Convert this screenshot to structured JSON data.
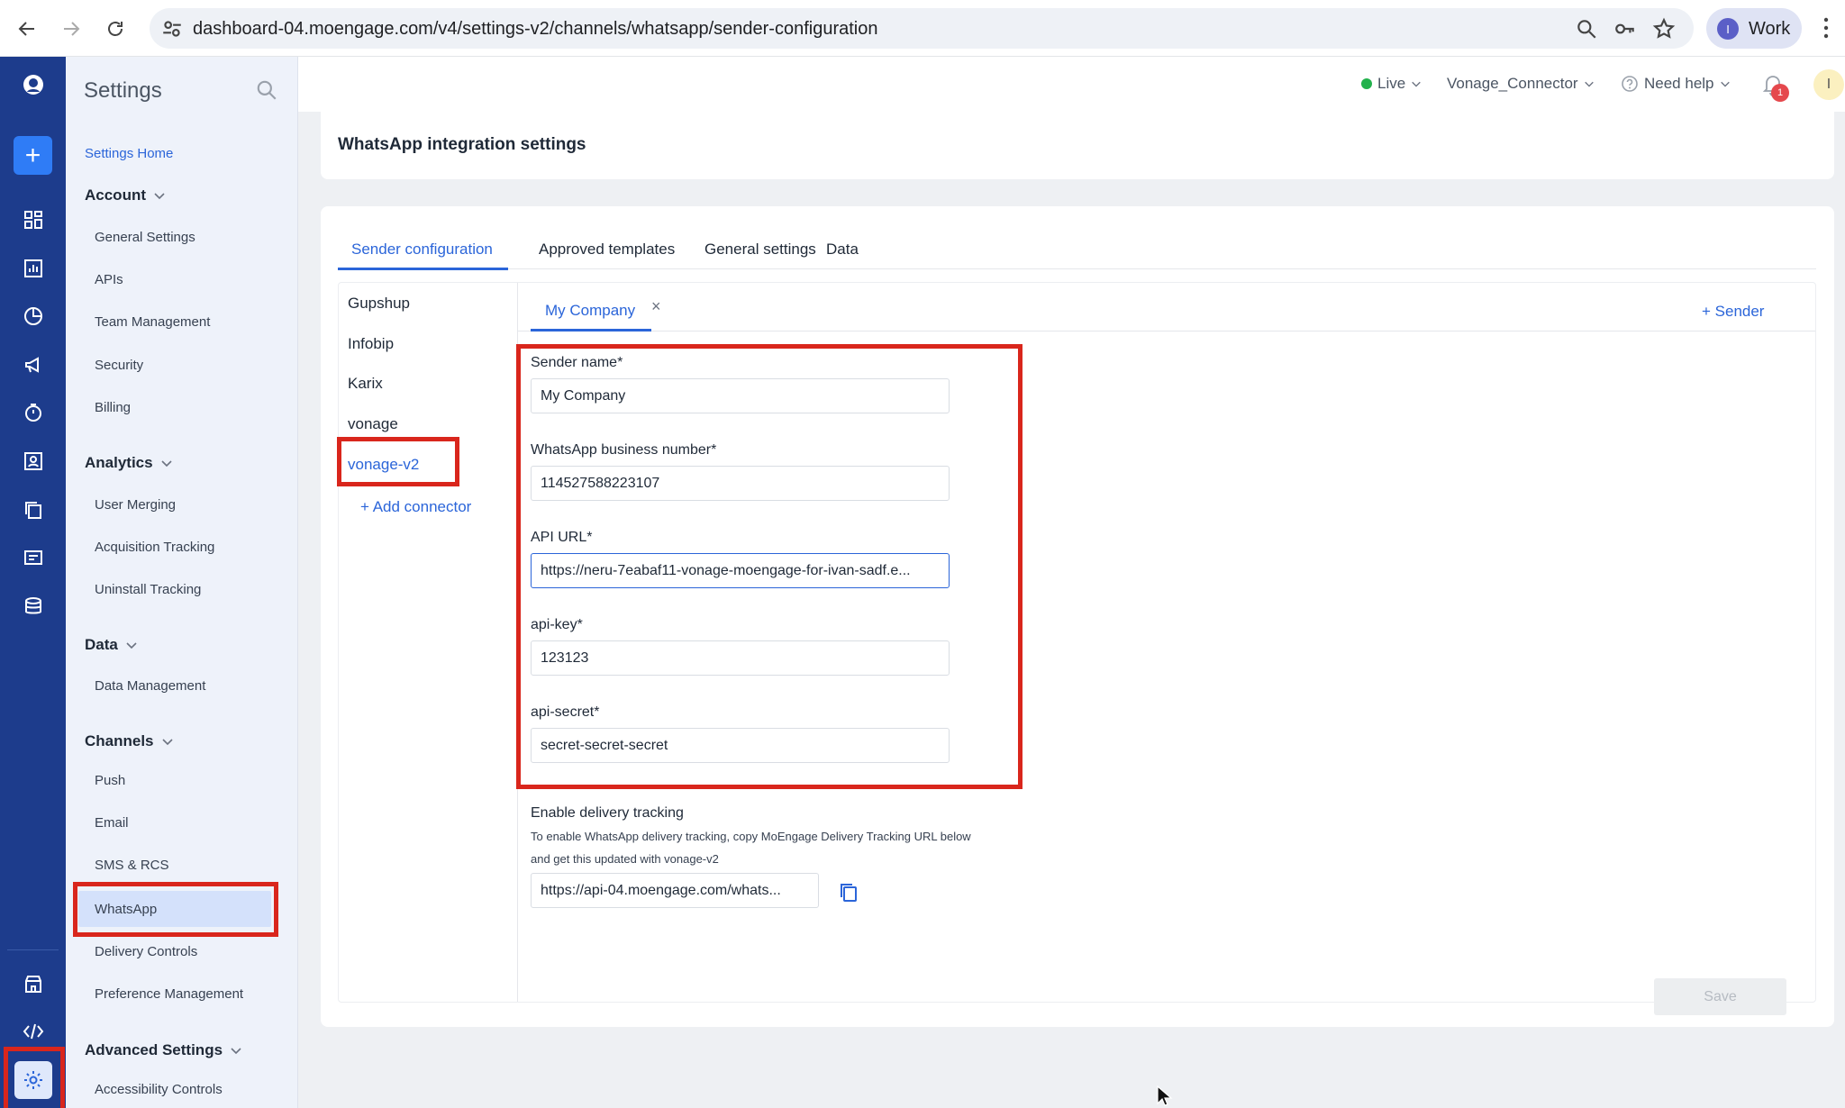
{
  "browser": {
    "url": "dashboard-04.moengage.com/v4/settings-v2/channels/whatsapp/sender-configuration",
    "profile_initial": "I",
    "profile_label": "Work"
  },
  "sidebar": {
    "title": "Settings",
    "home": "Settings Home",
    "sections": [
      {
        "title": "Account",
        "items": [
          "General Settings",
          "APIs",
          "Team Management",
          "Security",
          "Billing"
        ]
      },
      {
        "title": "Analytics",
        "items": [
          "User Merging",
          "Acquisition Tracking",
          "Uninstall Tracking"
        ]
      },
      {
        "title": "Data",
        "items": [
          "Data Management"
        ]
      },
      {
        "title": "Channels",
        "items": [
          "Push",
          "Email",
          "SMS & RCS",
          "WhatsApp",
          "Delivery Controls",
          "Preference Management"
        ]
      },
      {
        "title": "Advanced Settings",
        "items": [
          "Accessibility Controls"
        ]
      }
    ]
  },
  "topbar": {
    "env": "Live",
    "workspace": "Vonage_Connector",
    "help": "Need help",
    "notification_count": "1",
    "user_initial": "I"
  },
  "page": {
    "title": "WhatsApp integration settings",
    "tabs": [
      "Sender configuration",
      "Approved templates",
      "General settings",
      "Data"
    ],
    "connectors": [
      "Gupshup",
      "Infobip",
      "Karix",
      "vonage",
      "vonage-v2"
    ],
    "add_connector": "+ Add connector",
    "sender_tab": "My Company",
    "sender_tab_close": "×",
    "add_sender": "+ Sender",
    "fields": {
      "sender_name_label": "Sender name*",
      "sender_name_value": "My Company",
      "business_number_label": "WhatsApp business number*",
      "business_number_value": "114527588223107",
      "api_url_label": "API URL*",
      "api_url_value": "https://neru-7eabaf11-vonage-moengage-for-ivan-sadf.e...",
      "api_key_label": "api-key*",
      "api_key_value": "123123",
      "api_secret_label": "api-secret*",
      "api_secret_value": "secret-secret-secret"
    },
    "delivery": {
      "title": "Enable delivery tracking",
      "note_line1": "To enable WhatsApp delivery tracking, copy MoEngage Delivery Tracking URL below",
      "note_line2": "and get this updated with vonage-v2",
      "url": "https://api-04.moengage.com/whats..."
    },
    "save": "Save"
  },
  "colors": {
    "rail": "#1d3c8c",
    "accent": "#2b65d9",
    "highlight": "#d9261c",
    "live": "#22b14c"
  }
}
